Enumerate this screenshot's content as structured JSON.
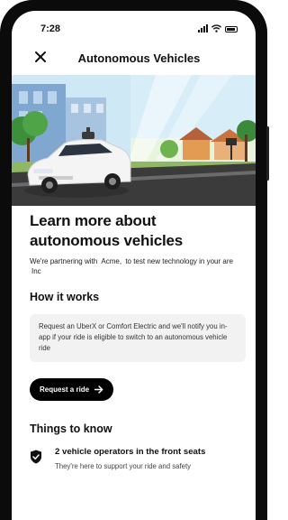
{
  "status_bar": {
    "time": "7:28"
  },
  "nav": {
    "title": "Autonomous Vehicles",
    "close_icon": "close-icon"
  },
  "hero": {
    "alt": "autonomous-car-illustration"
  },
  "intro": {
    "heading": "Learn more about autonomous vehicles",
    "text_before": "We're partnering with ",
    "partner_name_1": "Acme,",
    "partner_name_2": "Inc",
    "text_mid": " to test new technology in your are"
  },
  "how_it_works": {
    "title": "How it works",
    "body": "Request an UberX or Comfort Electric and we'll notify you in-app if your ride is eligible to switch to an autonomous vehicle ride",
    "cta_label": "Request a ride",
    "cta_icon": "arrow-right-icon"
  },
  "things_to_know": {
    "title": "Things to know",
    "items": [
      {
        "icon": "shield-check-icon",
        "title": "2 vehicle operators in the front seats",
        "subtitle": "They're here to support your ride and safety"
      }
    ]
  },
  "colors": {
    "accent": "#000000",
    "card_bg": "#f2f2f2",
    "sky": "#cfe8f5"
  }
}
